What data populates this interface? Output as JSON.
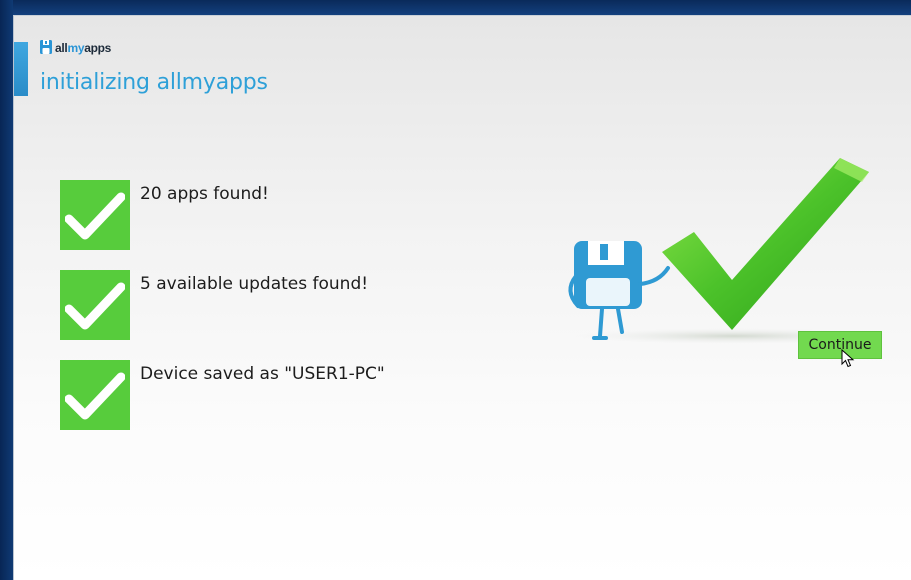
{
  "app": {
    "brand_all": "all",
    "brand_my": "my",
    "brand_apps": "apps",
    "title": "initializing allmyapps"
  },
  "results": [
    {
      "label": "20 apps found!",
      "icon": "checkmark-icon"
    },
    {
      "label": "5 available updates found!",
      "icon": "checkmark-icon"
    },
    {
      "label": "Device saved as \"USER1-PC\"",
      "icon": "checkmark-icon"
    }
  ],
  "actions": {
    "continue_label": "Continue"
  },
  "colors": {
    "accent_blue": "#2ea0d8",
    "check_green": "#57cc3c",
    "button_green": "#72d94f"
  }
}
